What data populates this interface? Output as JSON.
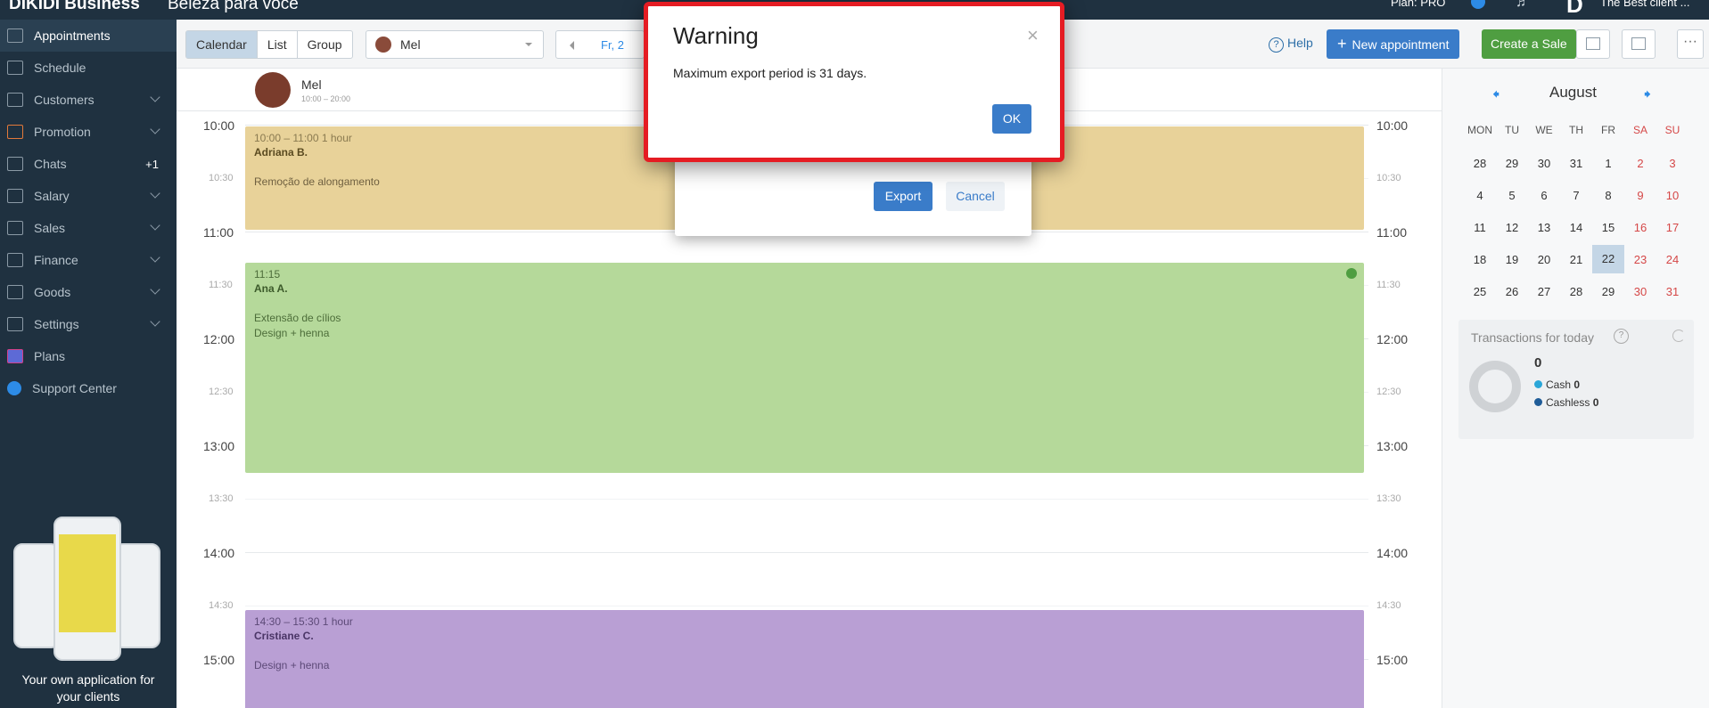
{
  "app": {
    "brand": "DIKIDI Business",
    "salon": "Beleza para você",
    "plan": "Plan: PRO",
    "client_name": "The Best client ..."
  },
  "sidebar": {
    "items": [
      {
        "label": "Appointments",
        "icon": "calendar-icon"
      },
      {
        "label": "Schedule",
        "icon": "grid-icon"
      },
      {
        "label": "Customers",
        "icon": "users-icon"
      },
      {
        "label": "Promotion",
        "icon": "rocket-icon"
      },
      {
        "label": "Chats",
        "icon": "chat-icon",
        "badge": "+1"
      },
      {
        "label": "Salary",
        "icon": "salary-icon"
      },
      {
        "label": "Sales",
        "icon": "receipt-icon"
      },
      {
        "label": "Finance",
        "icon": "finance-icon"
      },
      {
        "label": "Goods",
        "icon": "cart-icon"
      },
      {
        "label": "Settings",
        "icon": "gear-icon"
      },
      {
        "label": "Plans",
        "icon": "layers-icon"
      },
      {
        "label": "Support Center",
        "icon": "help-icon"
      }
    ],
    "promo_text": "Your own application for your clients"
  },
  "toolbar": {
    "views": [
      "Calendar",
      "List",
      "Group"
    ],
    "active_view": "Calendar",
    "staff": "Mel",
    "date": "Fr, 2",
    "help": "Help",
    "new_appointment": "New appointment",
    "create_sale": "Create a Sale",
    "more": "···"
  },
  "calendar": {
    "staff_name": "Mel",
    "staff_hours": "10:00 – 20:00",
    "times": [
      "10:00",
      "10:30",
      "11:00",
      "11:30",
      "12:00",
      "12:30",
      "13:00",
      "13:30",
      "14:00",
      "14:30",
      "15:00"
    ],
    "appointments": [
      {
        "time": "10:00 – 11:00   1 hour",
        "client": "Adriana B.",
        "services": [
          "Remoção de alongamento"
        ]
      },
      {
        "time": "11:15",
        "client": "Ana A.",
        "services": [
          "Extensão de cílios",
          "Design + henna"
        ]
      },
      {
        "time": "14:30 – 15:30   1 hour",
        "client": "Cristiane C.",
        "services": [
          "Design + henna"
        ]
      }
    ]
  },
  "minical": {
    "month": "August",
    "weekdays": [
      "MON",
      "TU",
      "WE",
      "TH",
      "FR",
      "SA",
      "SU"
    ],
    "weeks": [
      [
        "28",
        "29",
        "30",
        "31",
        "1",
        "2",
        "3"
      ],
      [
        "4",
        "5",
        "6",
        "7",
        "8",
        "9",
        "10"
      ],
      [
        "11",
        "12",
        "13",
        "14",
        "15",
        "16",
        "17"
      ],
      [
        "18",
        "19",
        "20",
        "21",
        "22",
        "23",
        "24"
      ],
      [
        "25",
        "26",
        "27",
        "28",
        "29",
        "30",
        "31"
      ]
    ],
    "today": "22"
  },
  "transactions": {
    "title": "Transactions for today",
    "total": "0",
    "cash_label": "Cash",
    "cash_value": "0",
    "cashless_label": "Cashless",
    "cashless_value": "0"
  },
  "export_dialog": {
    "export_label": "Export",
    "cancel_label": "Cancel"
  },
  "warning_dialog": {
    "title": "Warning",
    "message": "Maximum export period is 31 days.",
    "ok_label": "OK",
    "close": "×"
  },
  "colors": {
    "sidebar": "#1f3140",
    "accent": "#3a7cc9",
    "sale": "#4f9e41",
    "warning_border": "#e51c23"
  }
}
